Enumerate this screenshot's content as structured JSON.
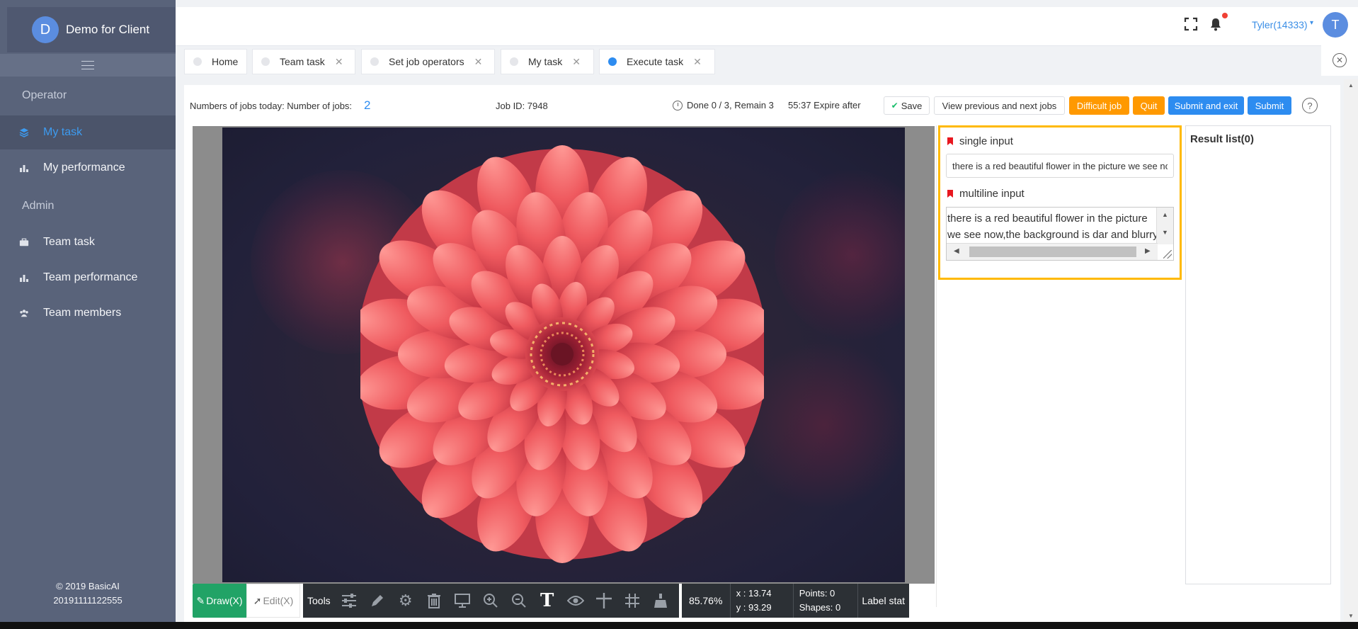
{
  "app": {
    "brand_initial": "D",
    "brand_name": "Demo for Client"
  },
  "sidebar": {
    "section_operator": "Operator",
    "section_admin": "Admin",
    "items": [
      {
        "label": "My task",
        "icon": "layers-icon",
        "active": true
      },
      {
        "label": "My performance",
        "icon": "bar-chart-icon"
      },
      {
        "label": "Team task",
        "icon": "briefcase-icon"
      },
      {
        "label": "Team performance",
        "icon": "bar-chart-icon"
      },
      {
        "label": "Team members",
        "icon": "group-icon"
      }
    ],
    "footer_line1": "© 2019 BasicAI",
    "footer_line2": "20191111122555"
  },
  "header": {
    "user_name": "Tyler(14333)",
    "user_initial": "T"
  },
  "tabs": [
    {
      "label": "Home",
      "closable": false,
      "active": false
    },
    {
      "label": "Team task",
      "closable": true,
      "active": false
    },
    {
      "label": "Set job operators",
      "closable": true,
      "active": false
    },
    {
      "label": "My task",
      "closable": true,
      "active": false
    },
    {
      "label": "Execute task",
      "closable": true,
      "active": true
    }
  ],
  "job": {
    "jobs_today_label": "Numbers of jobs today: Number of jobs:",
    "jobs_today_count": "2",
    "job_id_text": "Job ID: 7948",
    "progress_text": "Done 0 / 3, Remain 3",
    "expire_text": "55:37 Expire after"
  },
  "buttons": {
    "save": "Save",
    "view_prev_next": "View previous and next jobs",
    "difficult": "Difficult job",
    "quit": "Quit",
    "submit_exit": "Submit and exit",
    "submit": "Submit",
    "help": "?"
  },
  "toolbar": {
    "draw": "Draw(X)",
    "edit": "Edit(X)",
    "tools": "Tools",
    "icons": [
      "sliders-icon",
      "pencil-icon",
      "gear-icon",
      "trash-icon",
      "monitor-icon",
      "zoom-in-icon",
      "zoom-out-icon",
      "text-icon",
      "eye-icon",
      "crosshair-icon",
      "grid-icon",
      "brush-icon"
    ],
    "zoom": "85.76%",
    "x_text": "x : 13.74",
    "y_text": "y : 93.29",
    "points_text": "Points:  0",
    "shapes_text": "Shapes:  0",
    "label_stat": "Label stat"
  },
  "form": {
    "single_label": "single input",
    "single_value": "there is a red beautiful flower in the picture we see now",
    "multi_label": "multiline input",
    "multi_line1": "there is a red beautiful flower in the picture",
    "multi_line2": "we see now,the background is dar and blurry"
  },
  "result": {
    "title": "Result list(0)"
  },
  "colors": {
    "sidebar_bg": "#59637a",
    "accent_blue": "#2d8cf0",
    "accent_orange": "#ff9900",
    "draw_green": "#21a366",
    "highlight_yellow": "#ffb900"
  }
}
